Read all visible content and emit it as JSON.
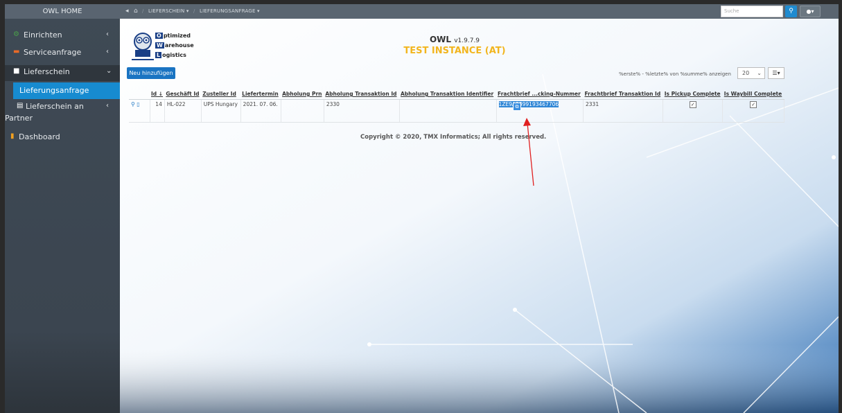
{
  "sidebar": {
    "brand": "OWL HOME",
    "items": [
      {
        "label": "Einrichten",
        "icon": "gear-icon"
      },
      {
        "label": "Serviceanfrage",
        "icon": "inbox-icon"
      },
      {
        "label": "Lieferschein",
        "icon": "document-icon"
      },
      {
        "label": "Lieferungsanfrage",
        "icon": ""
      },
      {
        "label": "Lieferschein an",
        "label2": "Partner",
        "icon": "document-icon"
      },
      {
        "label": "Dashboard",
        "icon": "bar-chart-icon"
      }
    ]
  },
  "topnav": {
    "crumbs": [
      "LIEFERSCHEIN ▾",
      "LIEFERUNGSANFRAGE ▾"
    ],
    "search_placeholder": "Suche"
  },
  "header": {
    "logo_words": [
      {
        "initial": "O",
        "rest": "ptimized"
      },
      {
        "initial": "W",
        "rest": "arehouse"
      },
      {
        "initial": "L",
        "rest": "ogistics"
      }
    ],
    "app_name": "OWL",
    "version": "v1.9.7.9",
    "instance": "TEST INSTANCE (AT)"
  },
  "toolbar": {
    "add_label": "Neu hinzufügen",
    "paging_text": "%erste% - %letzte% von %summe% anzeigen",
    "page_size": "20"
  },
  "table": {
    "columns": [
      "Id ↓",
      "Geschäft Id",
      "Zusteller Id",
      "Liefertermin",
      "Abholung Prn",
      "Abholung Transaktion Id",
      "Abholung Transaktion Identifier",
      "Frachtbrief ...cking-Nummer",
      "Frachtbrief Transaktion Id",
      "Is Pickup Complete",
      "Is Waybill Complete"
    ],
    "rows": [
      {
        "id": "14",
        "geschaeft": "HL-022",
        "zusteller": "UPS Hungary",
        "liefertermin": "2021. 07. 06.",
        "prn": "",
        "abh_trans_id": "2330",
        "abh_trans_ident": "",
        "tracking": "1ZE9A2399193467706",
        "fb_trans_id": "2331",
        "pickup_complete": true,
        "waybill_complete": true
      }
    ]
  },
  "footer": {
    "copyright": "Copyright © 2020, TMX Informatics; All rights reserved."
  },
  "colors": {
    "accent": "#178bd0",
    "instance": "#f2b51e",
    "sidebar": "#3b4550"
  }
}
